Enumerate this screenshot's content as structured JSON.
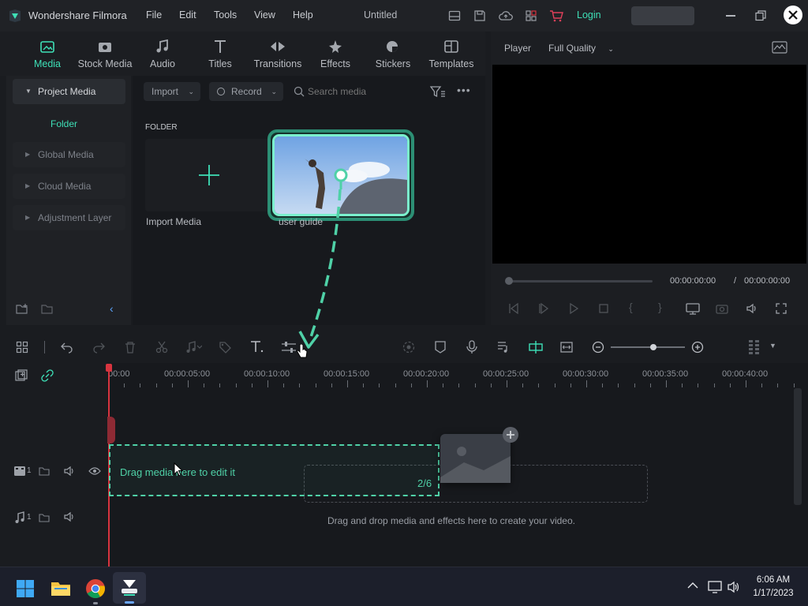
{
  "app": {
    "name": "Wondershare Filmora",
    "doc_title": "Untitled",
    "login": "Login"
  },
  "menu": [
    "File",
    "Edit",
    "Tools",
    "View",
    "Help"
  ],
  "panel_tabs": [
    {
      "label": "Media",
      "icon": "media-icon",
      "active": true
    },
    {
      "label": "Stock Media",
      "icon": "stock-media-icon"
    },
    {
      "label": "Audio",
      "icon": "music-note-icon"
    },
    {
      "label": "Titles",
      "icon": "text-t-icon"
    },
    {
      "label": "Transitions",
      "icon": "transitions-icon"
    },
    {
      "label": "Effects",
      "icon": "effects-icon"
    },
    {
      "label": "Stickers",
      "icon": "stickers-icon"
    },
    {
      "label": "Templates",
      "icon": "templates-icon"
    }
  ],
  "sidebar": {
    "project_media": "Project Media",
    "folder": "Folder",
    "items": [
      "Global Media",
      "Cloud Media",
      "Adjustment Layer"
    ]
  },
  "media": {
    "import_label": "Import",
    "record_label": "Record",
    "search_placeholder": "Search media",
    "folder_header": "FOLDER",
    "import_media_label": "Import Media",
    "clip_label": "user guide"
  },
  "player": {
    "label": "Player",
    "quality": "Full Quality",
    "current_time": "00:00:00:00",
    "separator": "/",
    "total_time": "00:00:00:00"
  },
  "timeline": {
    "ruler": [
      "00:00",
      "00:00:05:00",
      "00:00:10:00",
      "00:00:15:00",
      "00:00:20:00",
      "00:00:25:00",
      "00:00:30:00",
      "00:00:35:00",
      "00:00:40:00"
    ],
    "drag_hint": "Drag media here to edit it",
    "step_counter": "2/6",
    "drop_hint": "Drag and drop media and effects here to create your video.",
    "video_track_num": "1",
    "audio_track_num": "1"
  },
  "taskbar": {
    "time": "6:06 AM",
    "date": "1/17/2023"
  },
  "colors": {
    "accent": "#3ee0b7",
    "guide": "#4fd1a7",
    "playhead": "#d8343f",
    "bg": "#1a1c20"
  }
}
